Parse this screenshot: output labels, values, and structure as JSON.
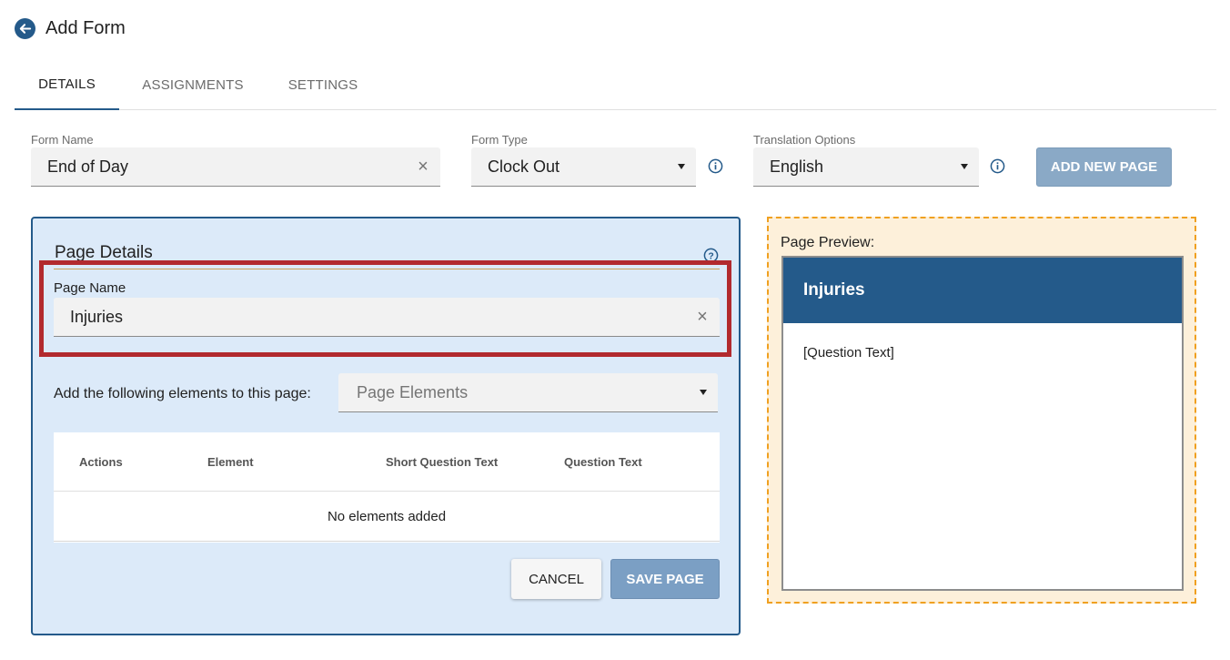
{
  "header": {
    "title": "Add Form",
    "back_icon": "arrow-left-icon"
  },
  "tabs": [
    {
      "label": "DETAILS",
      "active": true
    },
    {
      "label": "ASSIGNMENTS",
      "active": false
    },
    {
      "label": "SETTINGS",
      "active": false
    }
  ],
  "form": {
    "name": {
      "label": "Form Name",
      "value": "End of Day"
    },
    "type": {
      "label": "Form Type",
      "value": "Clock Out"
    },
    "translation": {
      "label": "Translation Options",
      "value": "English"
    },
    "add_page_label": "ADD NEW PAGE"
  },
  "page_details": {
    "title": "Page Details",
    "page_name": {
      "label": "Page Name",
      "value": "Injuries"
    },
    "elements_prompt": "Add the following elements to this page:",
    "elements_select_placeholder": "Page Elements",
    "table": {
      "columns": [
        "Actions",
        "Element",
        "Short Question Text",
        "Question Text"
      ],
      "empty_text": "No elements added"
    },
    "cancel_label": "CANCEL",
    "save_label": "SAVE PAGE"
  },
  "preview": {
    "label": "Page Preview:",
    "page_title": "Injuries",
    "question_text": "[Question Text]"
  },
  "colors": {
    "brand": "#245a8a",
    "button_disabled": "#8aa9c6",
    "panel_bg": "#dceaf9",
    "preview_bg": "#fdf0da",
    "preview_border": "#f0a020",
    "highlight": "#b22a2e"
  }
}
